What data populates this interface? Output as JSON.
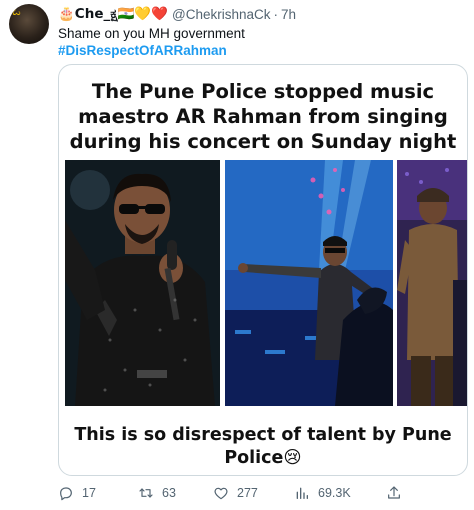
{
  "author": {
    "display_name": "🎂Che_ಕ್ಷ🇮🇳💛❤️",
    "handle": "@ChekrishnaCk",
    "separator": "·",
    "time": "7h",
    "avatar_glyph": "ಓ"
  },
  "tweet": {
    "text": "Shame on you MH government",
    "hashtag": "#DisRespectOfARRahman"
  },
  "media": {
    "headline": "The Pune Police stopped music maestro AR Rahman from singing during his concert on Sunday night",
    "caption": "This is so disrespect of talent by Pune Police😢"
  },
  "actions": {
    "replies": "17",
    "retweets": "63",
    "likes": "277",
    "views": "69.3K"
  },
  "colors": {
    "text_primary": "#0f1419",
    "text_secondary": "#536471",
    "link_blue": "#1d9bf0",
    "border": "#cfd9de"
  },
  "icons": [
    "reply-icon",
    "retweet-icon",
    "like-icon",
    "views-icon",
    "share-icon"
  ]
}
